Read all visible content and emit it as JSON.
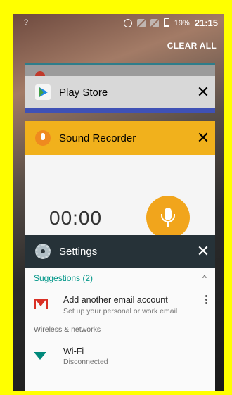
{
  "status_bar": {
    "left_icon": "wifi-unknown-icon",
    "left_text": "?",
    "battery_percent": "19%",
    "time": "21:15",
    "icons": [
      "alarm-icon",
      "no-sim-icon",
      "no-sim-icon",
      "battery-icon"
    ]
  },
  "recents": {
    "clear_all_label": "CLEAR ALL"
  },
  "cards": {
    "play_store": {
      "title": "Play Store",
      "accent": "#3f51b5"
    },
    "sound_recorder": {
      "title": "Sound Recorder",
      "timer": "00:00",
      "accent": "#f1b11c"
    },
    "settings": {
      "title": "Settings",
      "suggestions_label": "Suggestions (2)",
      "suggestion": {
        "title": "Add another email account",
        "subtitle": "Set up your personal or work email"
      },
      "section_label": "Wireless & networks",
      "wifi": {
        "title": "Wi-Fi",
        "subtitle": "Disconnected"
      },
      "accent": "#009688"
    }
  },
  "close_symbol": "✕",
  "caret_symbol": "^"
}
